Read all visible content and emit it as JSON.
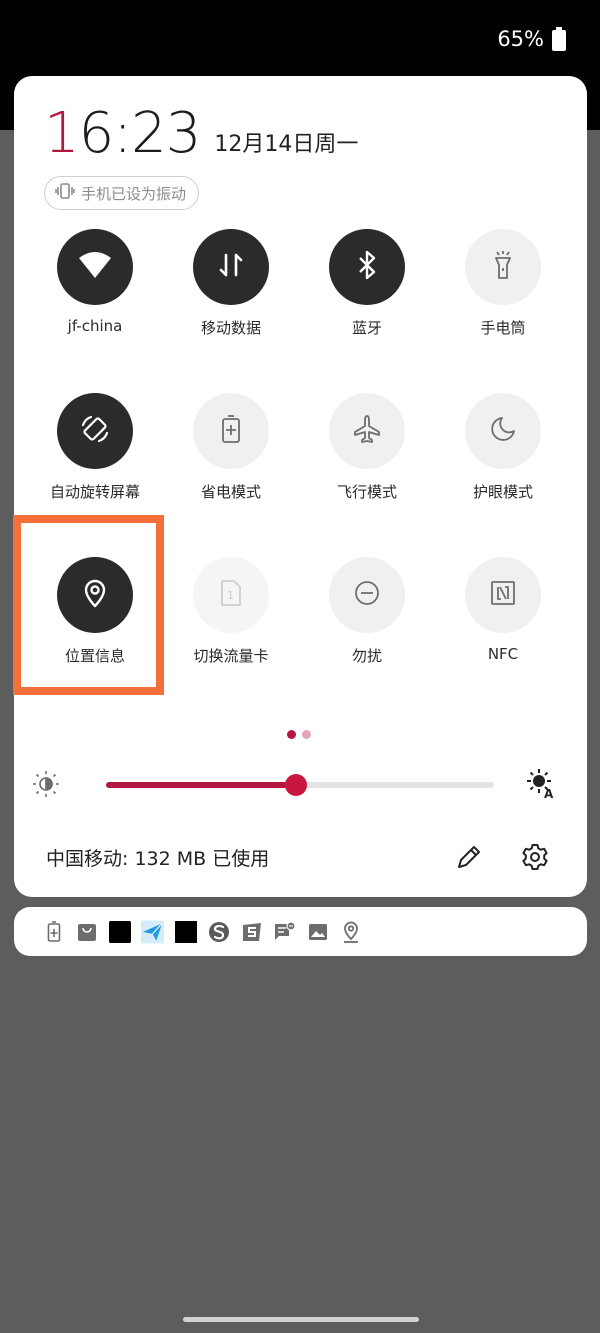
{
  "status_bar": {
    "battery_percent": "65%"
  },
  "clock": {
    "hour_first_digit": "1",
    "rest": "6:23",
    "date": "12月14日周一"
  },
  "vibrate_chip": {
    "label": "手机已设为振动"
  },
  "tiles": [
    {
      "label": "jf-china",
      "icon": "wifi-icon",
      "state": "on"
    },
    {
      "label": "移动数据",
      "icon": "mobile-data-icon",
      "state": "on"
    },
    {
      "label": "蓝牙",
      "icon": "bluetooth-icon",
      "state": "on"
    },
    {
      "label": "手电筒",
      "icon": "flashlight-icon",
      "state": "off"
    },
    {
      "label": "自动旋转屏幕",
      "icon": "auto-rotate-icon",
      "state": "on"
    },
    {
      "label": "省电模式",
      "icon": "battery-saver-icon",
      "state": "off"
    },
    {
      "label": "飞行模式",
      "icon": "airplane-icon",
      "state": "off"
    },
    {
      "label": "护眼模式",
      "icon": "moon-icon",
      "state": "off"
    },
    {
      "label": "位置信息",
      "icon": "location-icon",
      "state": "on"
    },
    {
      "label": "切换流量卡",
      "icon": "sim-card-icon",
      "state": "disabled"
    },
    {
      "label": "勿扰",
      "icon": "do-not-disturb-icon",
      "state": "off"
    },
    {
      "label": "NFC",
      "icon": "nfc-icon",
      "state": "off"
    }
  ],
  "pager": {
    "pages": 2,
    "current": 1
  },
  "brightness": {
    "level": 0.49
  },
  "carrier": {
    "text": "中国移动: 132 MB 已使用"
  },
  "colors": {
    "accent": "#b3173f",
    "tile_on": "#2b2b2b",
    "tile_off": "#f0f0f0",
    "highlight": "#f56f3a",
    "backdrop": "#5d5d5d"
  },
  "notification_icons": [
    "battery-icon",
    "shopping-bag-icon",
    "black-square-icon",
    "paper-plane-icon",
    "black-square-icon",
    "s-logo-icon",
    "s-app-icon",
    "message-icon",
    "image-icon",
    "location-icon"
  ]
}
